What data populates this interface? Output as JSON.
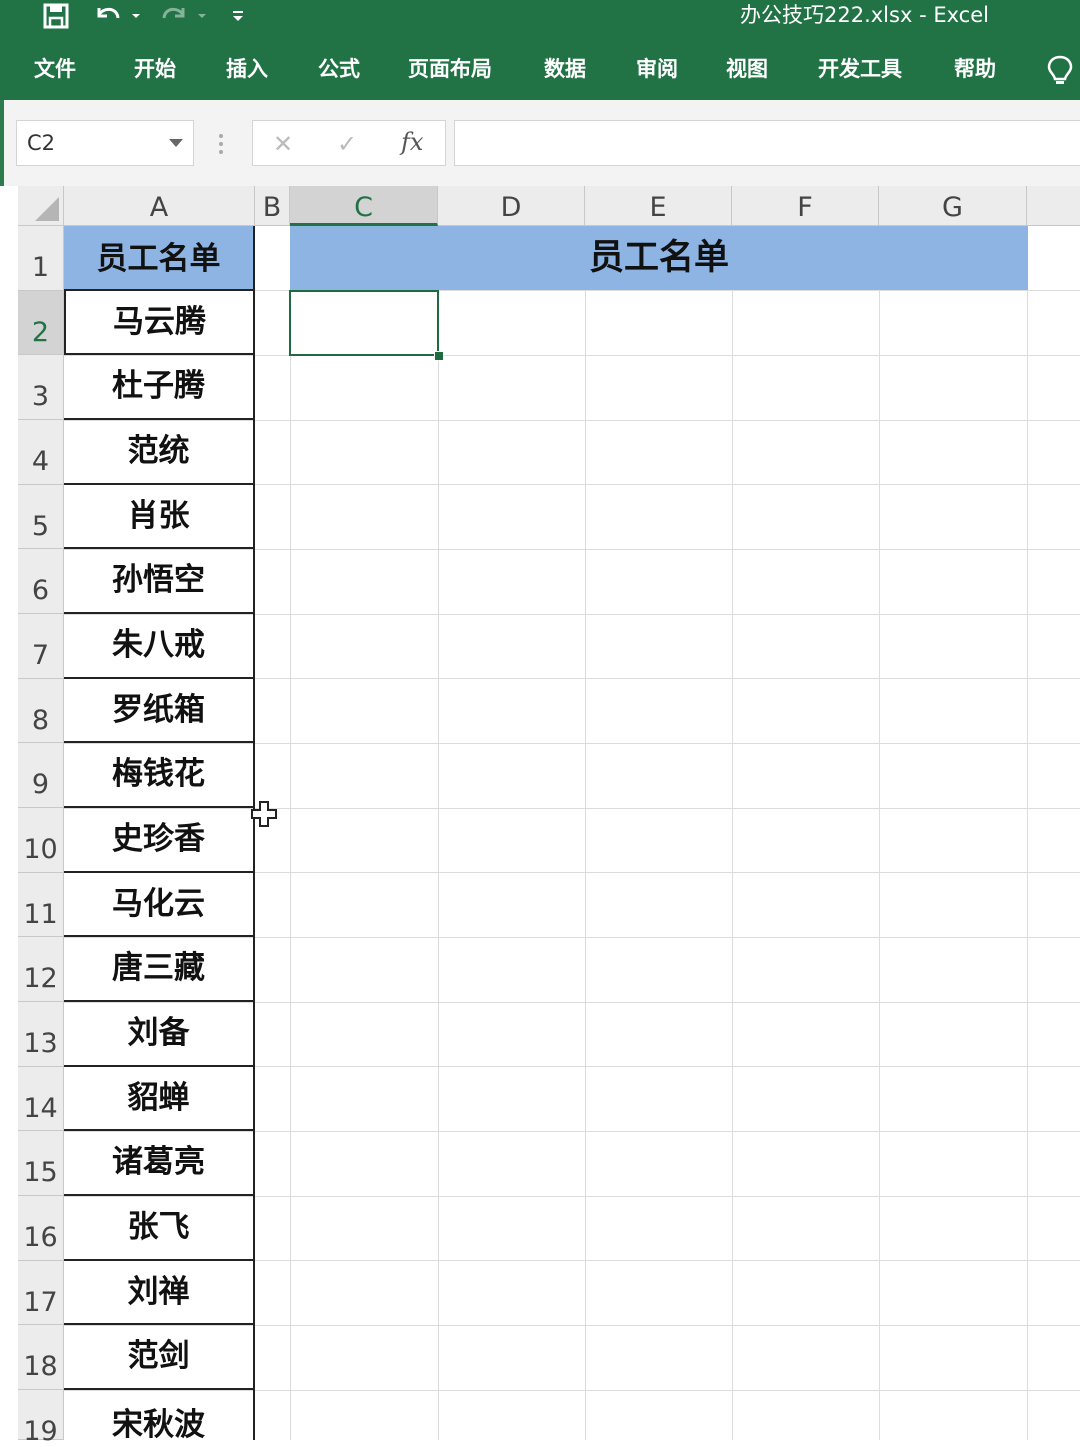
{
  "window": {
    "title": "办公技巧222.xlsx  -  Excel"
  },
  "ribbon": {
    "tabs": [
      "文件",
      "开始",
      "插入",
      "公式",
      "页面布局",
      "数据",
      "审阅",
      "视图",
      "开发工具",
      "帮助"
    ]
  },
  "formula_bar": {
    "name_box": "C2",
    "cancel_icon": "✕",
    "enter_icon": "✓",
    "fx_label": "fx",
    "value": ""
  },
  "sheet": {
    "columns": [
      "A",
      "B",
      "C",
      "D",
      "E",
      "F",
      "G"
    ],
    "active_column": "C",
    "rows": [
      "1",
      "2",
      "3",
      "4",
      "5",
      "6",
      "7",
      "8",
      "9",
      "10",
      "11",
      "12",
      "13",
      "14",
      "15",
      "16",
      "17",
      "18",
      "19"
    ],
    "active_row": "2",
    "a1_header": "员工名单",
    "merged_title": "员工名单",
    "names": [
      "马云腾",
      "杜子腾",
      "范统",
      "肖张",
      "孙悟空",
      "朱八戒",
      "罗纸箱",
      "梅钱花",
      "史珍香",
      "马化云",
      "唐三藏",
      "刘备",
      "貂蝉",
      "诸葛亮",
      "张飞",
      "刘禅",
      "范剑",
      "宋秋波"
    ],
    "selected_cell": "C2"
  },
  "colors": {
    "ribbon_green": "#217346",
    "header_fill": "#8db4e2"
  }
}
